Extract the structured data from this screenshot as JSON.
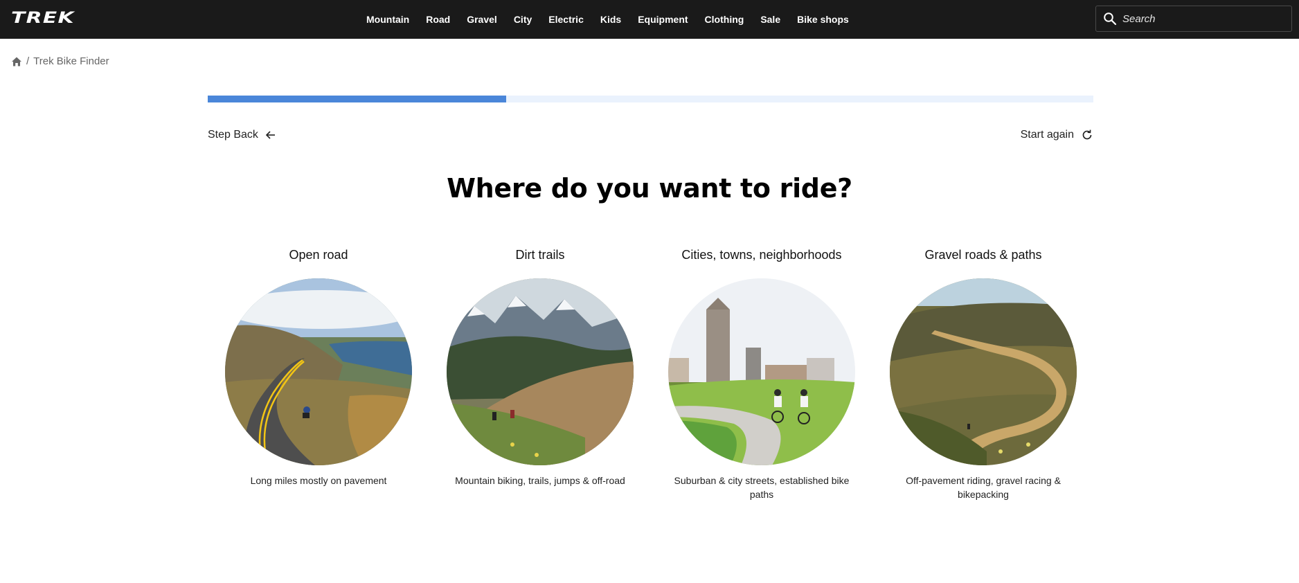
{
  "header": {
    "logo": "TREK",
    "nav": [
      "Mountain",
      "Road",
      "Gravel",
      "City",
      "Electric",
      "Kids",
      "Equipment",
      "Clothing",
      "Sale",
      "Bike shops"
    ],
    "search_placeholder": "Search"
  },
  "breadcrumb": {
    "separator": "/",
    "current": "Trek Bike Finder"
  },
  "progress": {
    "value": 0.337
  },
  "controls": {
    "step_back": "Step Back",
    "start_again": "Start again"
  },
  "question": "Where do you want to ride?",
  "options": [
    {
      "title": "Open road",
      "description": "Long miles mostly on pavement"
    },
    {
      "title": "Dirt trails",
      "description": "Mountain biking, trails, jumps & off-road"
    },
    {
      "title": "Cities, towns, neighborhoods",
      "description": "Suburban & city streets, established bike paths"
    },
    {
      "title": "Gravel roads & paths",
      "description": "Off-pavement riding, gravel racing & bikepacking"
    }
  ],
  "colors": {
    "header_bg": "#1a1a1a",
    "progress_fill": "#4a86d9",
    "progress_track": "#eaf2fd"
  }
}
